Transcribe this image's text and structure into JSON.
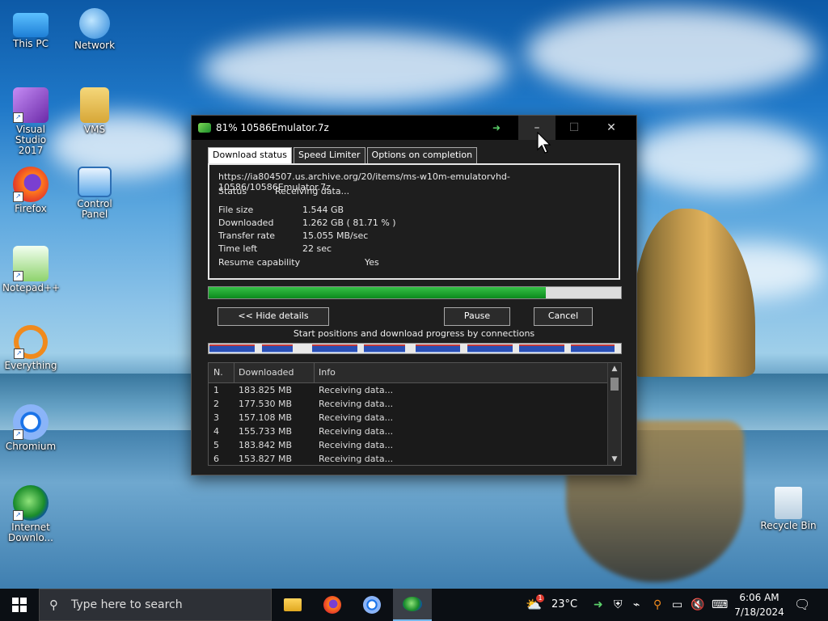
{
  "desktop": {
    "icons": [
      {
        "label": "This PC",
        "icon": "computer-icon"
      },
      {
        "label": "Network",
        "icon": "network-icon"
      },
      {
        "label": "Visual Studio 2017",
        "icon": "visual-studio-icon"
      },
      {
        "label": "VMS",
        "icon": "user-folder-icon"
      },
      {
        "label": "Firefox",
        "icon": "firefox-icon"
      },
      {
        "label": "Control Panel",
        "icon": "control-panel-icon"
      },
      {
        "label": "Notepad++",
        "icon": "notepadpp-icon"
      },
      {
        "label": "Everything",
        "icon": "search-magnifier-icon"
      },
      {
        "label": "Chromium",
        "icon": "chromium-icon"
      },
      {
        "label": "Internet Downlo...",
        "icon": "idm-icon"
      },
      {
        "label": "Recycle Bin",
        "icon": "recycle-bin-icon"
      }
    ]
  },
  "dialog": {
    "title": "81% 10586Emulator.7z",
    "tabs": [
      "Download status",
      "Speed Limiter",
      "Options on completion"
    ],
    "url": "https://ia804507.us.archive.org/20/items/ms-w10m-emulatorvhd-10586/10586Emulator.7z",
    "status_label": "Status",
    "status_value": "Receiving data...",
    "file_size_label": "File size",
    "file_size_value": "1.544 GB",
    "downloaded_label": "Downloaded",
    "downloaded_value": "1.262 GB ( 81.71 % )",
    "transfer_rate_label": "Transfer rate",
    "transfer_rate_value": "15.055 MB/sec",
    "time_left_label": "Time left",
    "time_left_value": "22 sec",
    "resume_label": "Resume capability",
    "resume_value": "Yes",
    "progress_fraction": 0.8171,
    "hide_details_label": "<< Hide details",
    "pause_label": "Pause",
    "cancel_label": "Cancel",
    "connections_caption": "Start positions and download progress by connections",
    "table": {
      "headers": [
        "N.",
        "Downloaded",
        "Info"
      ],
      "rows": [
        [
          "1",
          "183.825 MB",
          "Receiving data..."
        ],
        [
          "2",
          "177.530 MB",
          "Receiving data..."
        ],
        [
          "3",
          "157.108 MB",
          "Receiving data..."
        ],
        [
          "4",
          "155.733 MB",
          "Receiving data..."
        ],
        [
          "5",
          "183.842 MB",
          "Receiving data..."
        ],
        [
          "6",
          "153.827 MB",
          "Receiving data..."
        ]
      ]
    }
  },
  "taskbar": {
    "search_placeholder": "Type here to search",
    "weather_temp": "23°C",
    "weather_badge": "1",
    "time": "6:06 AM",
    "date": "7/18/2024"
  },
  "colors": {
    "progress_green": "#1faa2f",
    "taskbar_bg": "#0b0f14",
    "dialog_bg": "#1e1e1e"
  }
}
